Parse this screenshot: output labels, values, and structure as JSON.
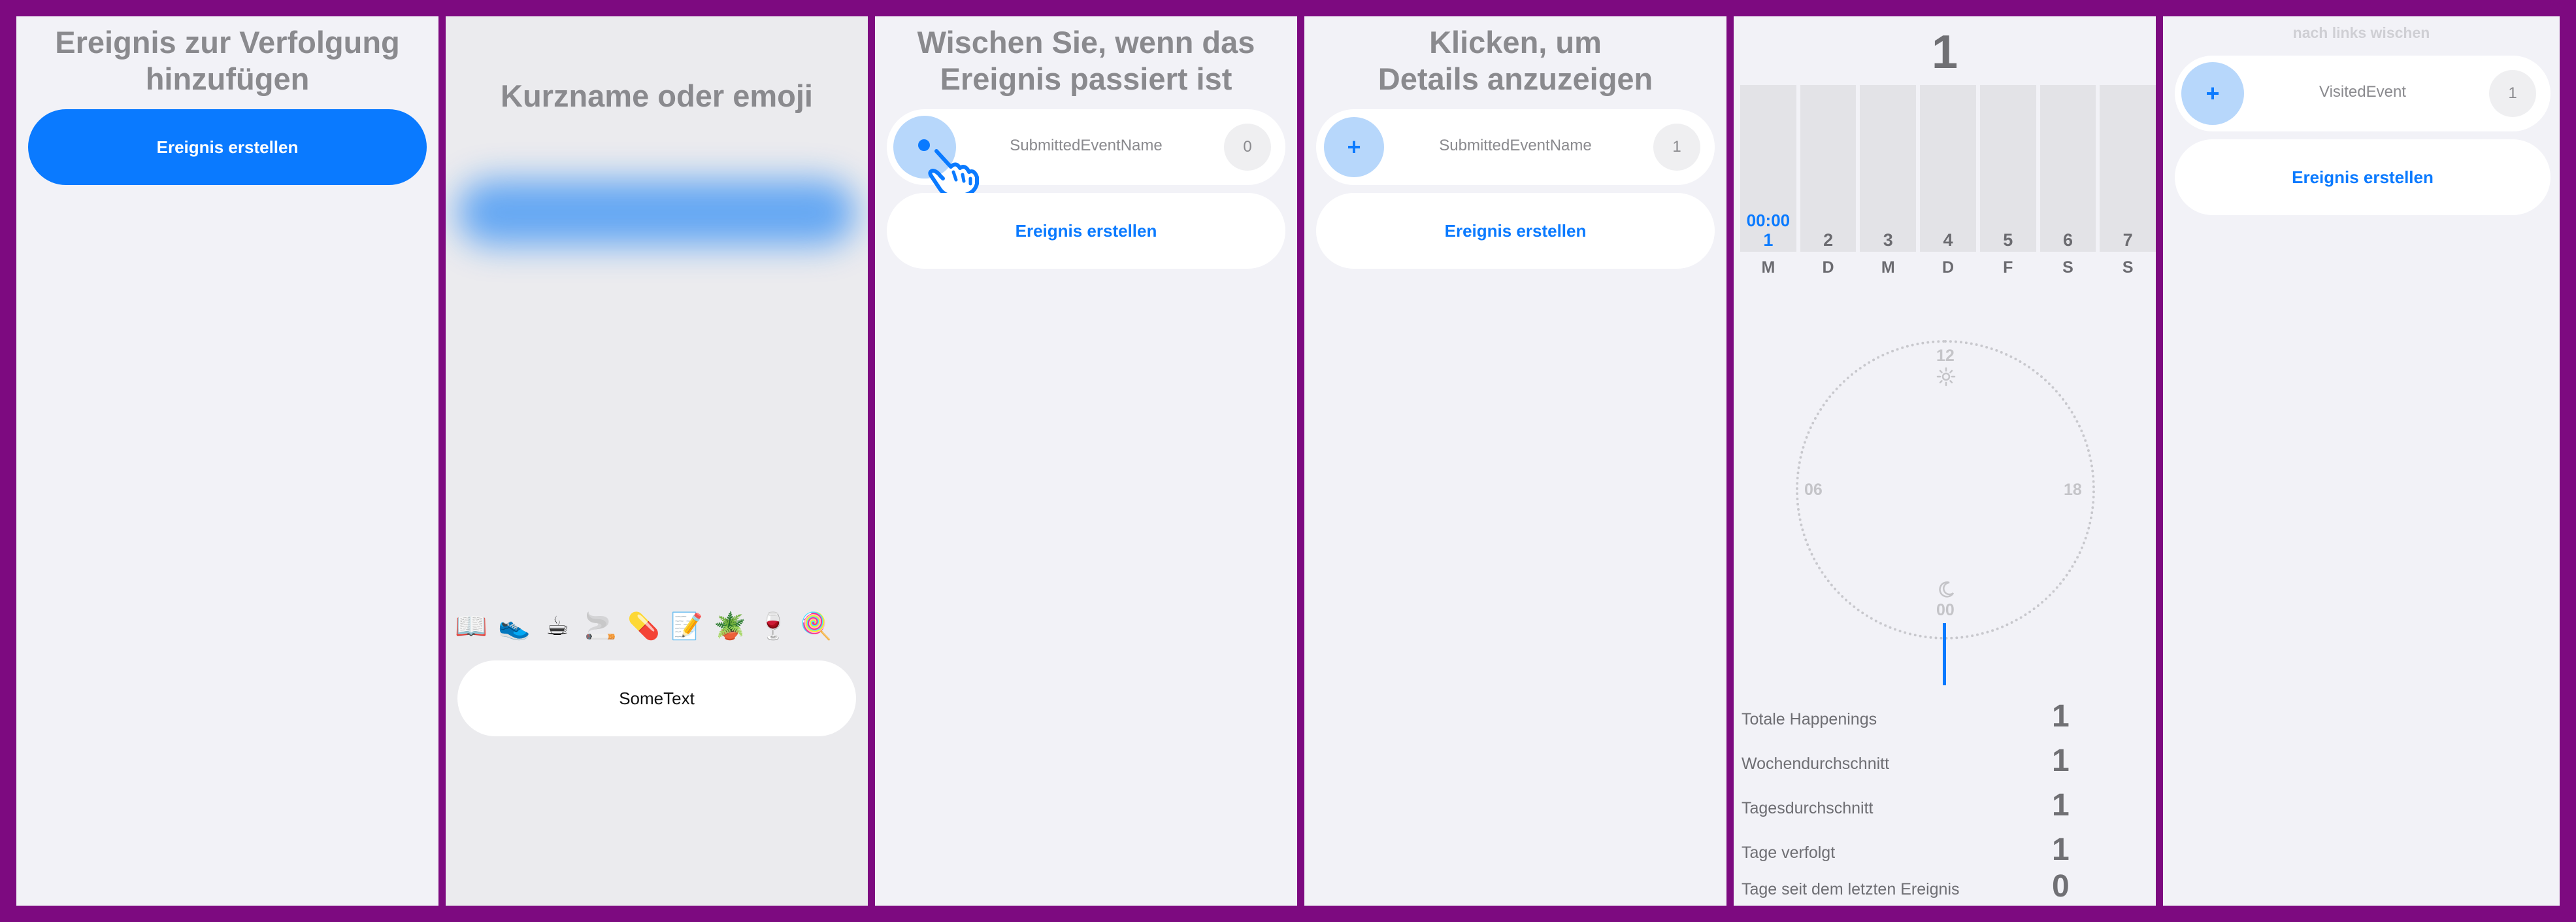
{
  "colors": {
    "accent": "#0a7aff",
    "frame": "#7d0a80",
    "background": "#f2f2f7"
  },
  "screen1": {
    "heading": "Ereignis zur Verfolgung\nhinzufügen",
    "create_button": "Ereignis erstellen"
  },
  "screen2": {
    "heading": "Kurzname oder emoji",
    "emojis": [
      "📖",
      "👟",
      "☕",
      "🚬",
      "💊",
      "📝",
      "🪴",
      "🍷",
      "🍭"
    ],
    "text_field_value": "SomeText"
  },
  "screen3": {
    "heading": "Wischen Sie, wenn das\nEreignis passiert ist",
    "event_name": "SubmittedEventName",
    "event_count": "0",
    "create_button": "Ereignis erstellen",
    "gesture_icon": "swipe-hand-icon"
  },
  "screen4": {
    "heading": "Klicken, um\nDetails anzuzeigen",
    "event_name": "SubmittedEventName",
    "event_count": "1",
    "add_symbol": "+",
    "create_button": "Ereignis erstellen"
  },
  "screen5": {
    "total": "1",
    "week": {
      "numbers": [
        "1",
        "2",
        "3",
        "4",
        "5",
        "6",
        "7"
      ],
      "letters": [
        "M",
        "D",
        "M",
        "D",
        "F",
        "S",
        "S"
      ],
      "active_time": "00:00"
    },
    "clock": {
      "labels": {
        "top": "12",
        "left": "06",
        "right": "18",
        "bottom": "00"
      },
      "top_icon": "sun-icon",
      "bottom_icon": "moon-icon"
    },
    "stats": [
      {
        "label": "Totale Happenings",
        "value": "1"
      },
      {
        "label": "Wochendurchschnitt",
        "value": "1"
      },
      {
        "label": "Tagesdurchschnitt",
        "value": "1"
      },
      {
        "label": "Tage verfolgt",
        "value": "1"
      },
      {
        "label": "Tage seit dem letzten Ereignis",
        "value": "0"
      }
    ]
  },
  "screen6": {
    "hint": "nach links wischen",
    "event_name": "VisitedEvent",
    "event_count": "1",
    "add_symbol": "+",
    "create_button": "Ereignis erstellen"
  }
}
